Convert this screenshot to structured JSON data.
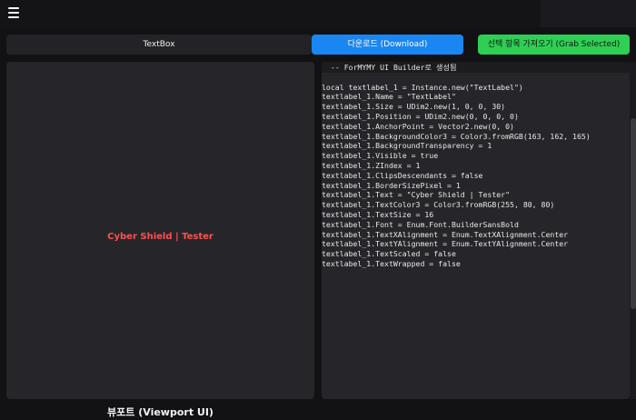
{
  "toolbar": {
    "textbox_label": "TextBox",
    "download_label": "다운로드 (Download)",
    "grab_label": "선택 항목 가져오기 (Grab Selected)"
  },
  "viewport": {
    "preview_text": "Cyber Shield | Tester",
    "caption": "뷰포트 (Viewport UI)"
  },
  "code": {
    "lines": [
      " -- ForMYMY UI Builder로 생성됨",
      "",
      "local textlabel_1 = Instance.new(\"TextLabel\")",
      "textlabel_1.Name = \"TextLabel\"",
      "textlabel_1.Size = UDim2.new(1, 0, 0, 30)",
      "textlabel_1.Position = UDim2.new(0, 0, 0, 0)",
      "textlabel_1.AnchorPoint = Vector2.new(0, 0)",
      "textlabel_1.BackgroundColor3 = Color3.fromRGB(163, 162, 165)",
      "textlabel_1.BackgroundTransparency = 1",
      "textlabel_1.Visible = true",
      "textlabel_1.ZIndex = 1",
      "textlabel_1.ClipsDescendants = false",
      "textlabel_1.BorderSizePixel = 1",
      "textlabel_1.Text = \"Cyber Shield | Tester\"",
      "textlabel_1.TextColor3 = Color3.fromRGB(255, 80, 80)",
      "textlabel_1.TextSize = 16",
      "textlabel_1.Font = Enum.Font.BuilderSansBold",
      "textlabel_1.TextXAlignment = Enum.TextXAlignment.Center",
      "textlabel_1.TextYAlignment = Enum.TextYAlignment.Center",
      "textlabel_1.TextScaled = false",
      "textlabel_1.TextWrapped = false"
    ]
  },
  "colors": {
    "background": "#121215",
    "panel": "#26262a",
    "download_button": "#1a86f2",
    "grab_button": "#2fcf55",
    "preview_text": "#ff5050"
  },
  "icons": {
    "menu": "hamburger-menu-icon"
  }
}
